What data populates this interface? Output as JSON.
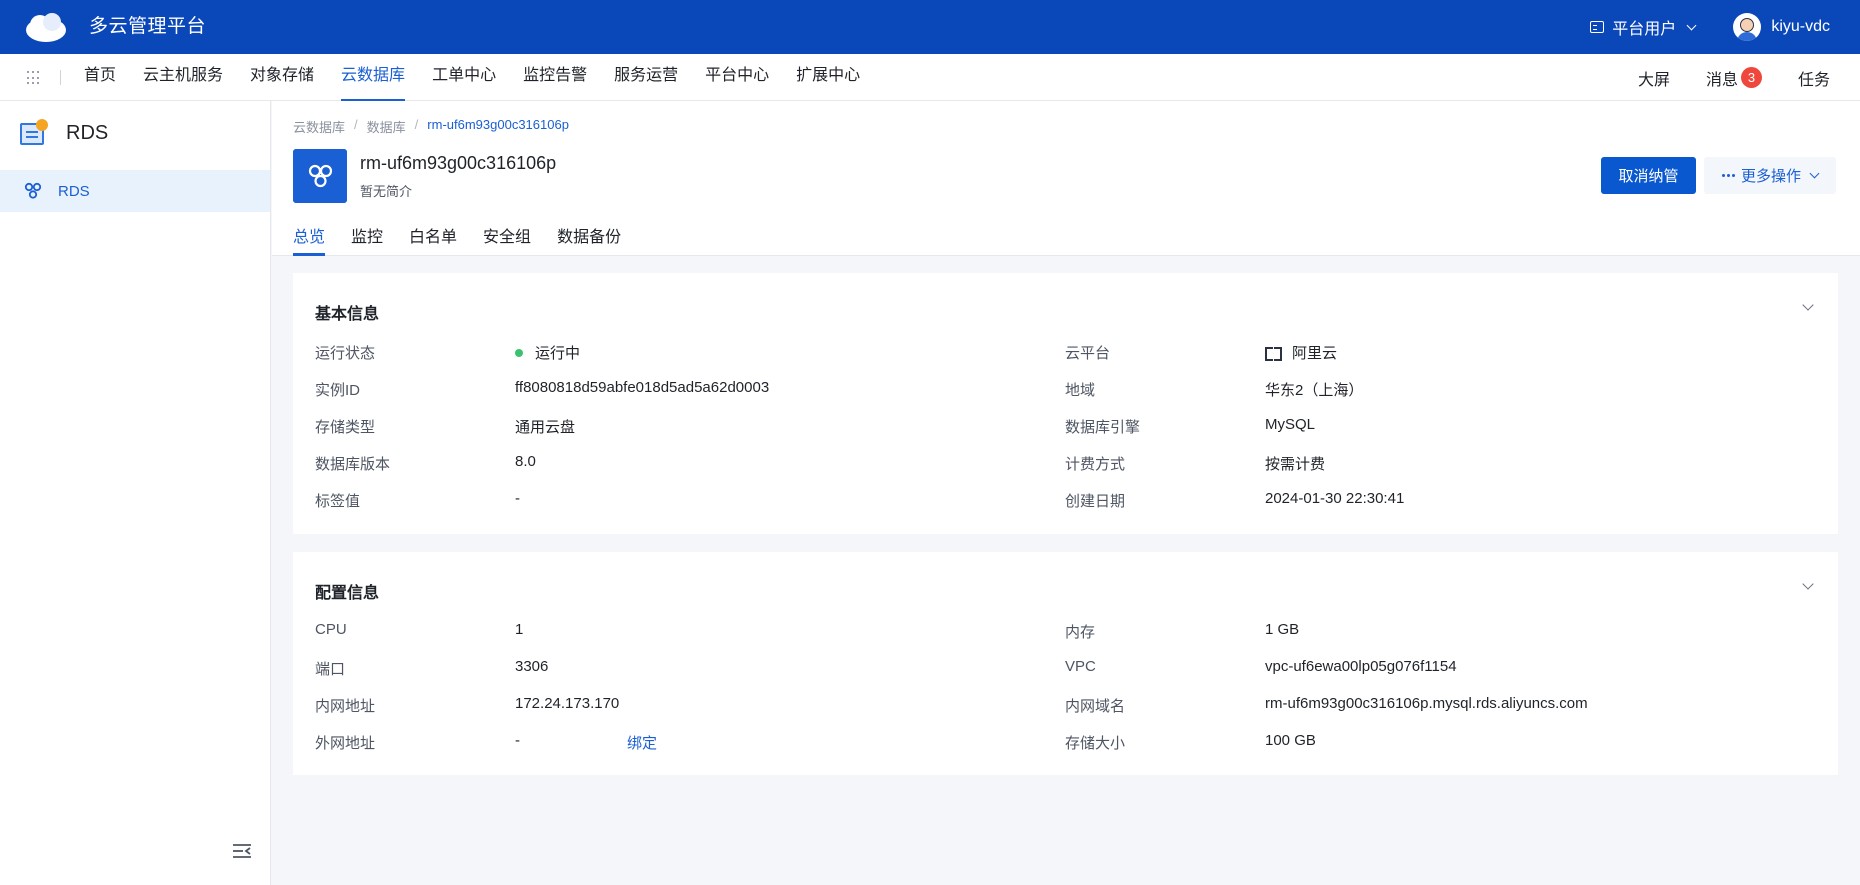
{
  "header": {
    "app_title": "多云管理平台",
    "user_type": "平台用户",
    "username": "kiyu-vdc"
  },
  "nav": {
    "items": [
      {
        "label": "首页",
        "active": false
      },
      {
        "label": "云主机服务",
        "active": false
      },
      {
        "label": "对象存储",
        "active": false
      },
      {
        "label": "云数据库",
        "active": true
      },
      {
        "label": "工单中心",
        "active": false
      },
      {
        "label": "监控告警",
        "active": false
      },
      {
        "label": "服务运营",
        "active": false
      },
      {
        "label": "平台中心",
        "active": false
      },
      {
        "label": "扩展中心",
        "active": false
      }
    ],
    "right": {
      "screen": "大屏",
      "messages": "消息",
      "message_count": "3",
      "tasks": "任务"
    }
  },
  "sidebar": {
    "title": "RDS",
    "items": [
      {
        "label": "RDS",
        "active": true
      }
    ]
  },
  "page": {
    "breadcrumb": [
      "云数据库",
      "数据库",
      "rm-uf6m93g00c316106p"
    ],
    "resource_name": "rm-uf6m93g00c316106p",
    "resource_desc": "暂无简介",
    "unmanage_button": "取消纳管",
    "more_button": "更多操作",
    "tabs": [
      {
        "label": "总览",
        "active": true
      },
      {
        "label": "监控",
        "active": false
      },
      {
        "label": "白名单",
        "active": false
      },
      {
        "label": "安全组",
        "active": false
      },
      {
        "label": "数据备份",
        "active": false
      }
    ]
  },
  "basic_info": {
    "title": "基本信息",
    "left": [
      {
        "label": "运行状态",
        "value": "运行中"
      },
      {
        "label": "实例ID",
        "value": "ff8080818d59abfe018d5ad5a62d0003"
      },
      {
        "label": "存储类型",
        "value": "通用云盘"
      },
      {
        "label": "数据库版本",
        "value": "8.0"
      },
      {
        "label": "标签值",
        "value": "-"
      }
    ],
    "right": [
      {
        "label": "云平台",
        "value": "阿里云"
      },
      {
        "label": "地域",
        "value": "华东2（上海）"
      },
      {
        "label": "数据库引擎",
        "value": "MySQL"
      },
      {
        "label": "计费方式",
        "value": "按需计费"
      },
      {
        "label": "创建日期",
        "value": "2024-01-30 22:30:41"
      }
    ]
  },
  "config_info": {
    "title": "配置信息",
    "left": [
      {
        "label": "CPU",
        "value": "1"
      },
      {
        "label": "端口",
        "value": "3306"
      },
      {
        "label": "内网地址",
        "value": "172.24.173.170"
      },
      {
        "label": "外网地址",
        "value": "-",
        "action": "绑定"
      }
    ],
    "right": [
      {
        "label": "内存",
        "value": "1 GB"
      },
      {
        "label": "VPC",
        "value": "vpc-uf6ewa00lp05g076f1154"
      },
      {
        "label": "内网域名",
        "value": "rm-uf6m93g00c316106p.mysql.rds.aliyuncs.com"
      },
      {
        "label": "存储大小",
        "value": "100 GB"
      }
    ]
  },
  "colors": {
    "brand": "#0a47b8",
    "accent": "#1a5fd4",
    "status_running": "#3cc26f",
    "badge": "#f0473c"
  }
}
